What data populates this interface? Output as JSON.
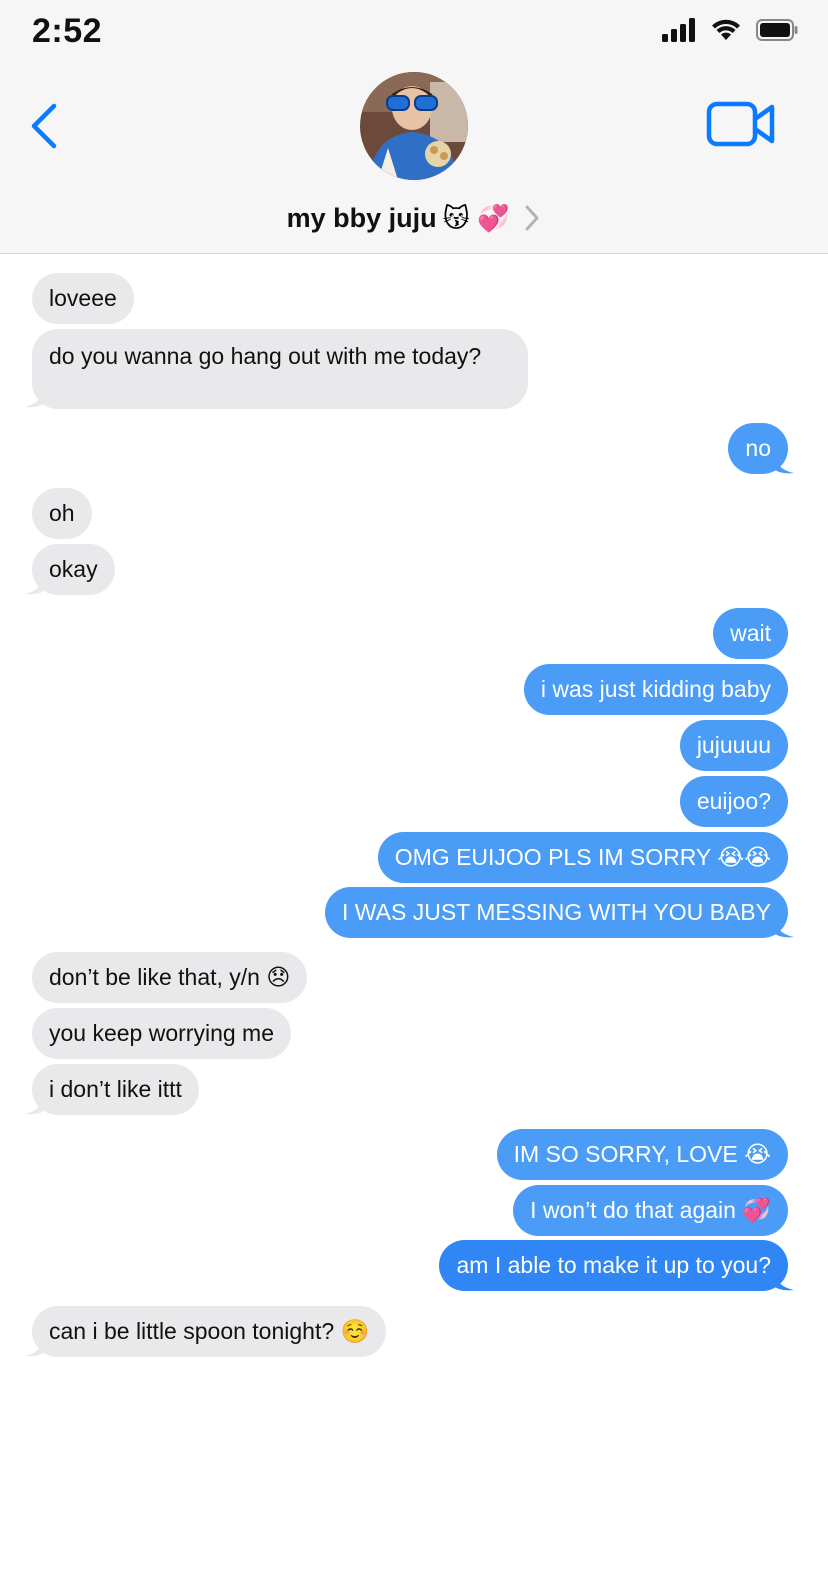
{
  "status_bar": {
    "time": "2:52",
    "signal_icon": "cellular-signal-icon",
    "wifi_icon": "wifi-icon",
    "battery_icon": "battery-icon"
  },
  "header": {
    "back_icon": "chevron-left-icon",
    "contact_name": "my bby juju",
    "contact_emojis": "😽 💞",
    "video_icon": "video-camera-icon",
    "accent_color": "#0a7aff"
  },
  "messages": [
    {
      "side": "in",
      "text": "loveee"
    },
    {
      "side": "in",
      "text": "do you wanna go hang out with me today?"
    },
    {
      "side": "out",
      "text": "no"
    },
    {
      "side": "in",
      "text": "oh"
    },
    {
      "side": "in",
      "text": "okay"
    },
    {
      "side": "out",
      "text": "wait"
    },
    {
      "side": "out",
      "text": "i was just kidding baby"
    },
    {
      "side": "out",
      "text": "jujuuuu"
    },
    {
      "side": "out",
      "text": "euijoo?"
    },
    {
      "side": "out",
      "text": "OMG EUIJOO PLS IM SORRY 😭😭"
    },
    {
      "side": "out",
      "text": "I WAS JUST MESSING WITH YOU BABY"
    },
    {
      "side": "in",
      "text": "don’t be like that, y/n 😞"
    },
    {
      "side": "in",
      "text": "you keep worrying me"
    },
    {
      "side": "in",
      "text": "i don’t like ittt"
    },
    {
      "side": "out",
      "text": "IM SO SORRY, LOVE 😭"
    },
    {
      "side": "out",
      "text": "I won’t do that again 💞"
    },
    {
      "side": "out",
      "text": "am I able to make it up to you?"
    },
    {
      "side": "in",
      "text": "can i be little spoon tonight? ☺️"
    }
  ],
  "colors": {
    "incoming_bubble": "#e9e9eb",
    "outgoing_bubble": "#4a9cf7",
    "header_background": "#f6f6f6"
  }
}
